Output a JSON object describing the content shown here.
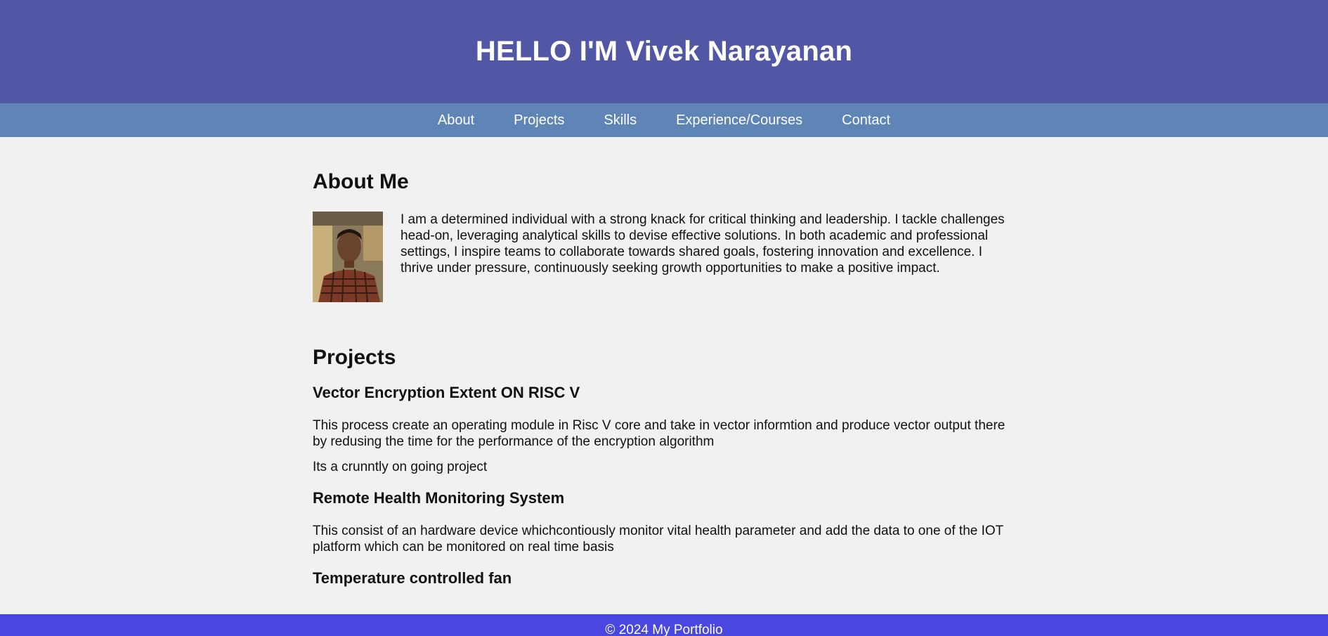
{
  "header": {
    "title": "HELLO I'M Vivek Narayanan"
  },
  "nav": {
    "items": [
      {
        "label": "About"
      },
      {
        "label": "Projects"
      },
      {
        "label": "Skills"
      },
      {
        "label": "Experience/Courses"
      },
      {
        "label": "Contact"
      }
    ]
  },
  "about": {
    "heading": "About Me",
    "text": "I am a determined individual with a strong knack for critical thinking and leadership. I tackle challenges head-on, leveraging analytical skills to devise effective solutions. In both academic and professional settings, I inspire teams to collaborate towards shared goals, fostering innovation and excellence. I thrive under pressure, continuously seeking growth opportunities to make a positive impact."
  },
  "projects": {
    "heading": "Projects",
    "items": [
      {
        "title": "Vector Encryption Extent ON RISC V",
        "description": "This process create an operating module in Risc V core and take in vector informtion and produce vector output there by redusing the time for the performance of the encryption algorithm",
        "note": "Its a crunntly on going project"
      },
      {
        "title": "Remote Health Monitoring System",
        "description": "This consist of an hardware device whichcontiously monitor vital health parameter and add the data to one of the IOT platform which can be monitored on real time basis"
      },
      {
        "title": "Temperature controlled fan"
      }
    ]
  },
  "footer": {
    "text": "© 2024 My Portfolio"
  },
  "colors": {
    "header_bg": "#5257a5",
    "nav_bg": "#5f85b6",
    "footer_bg": "#4a47e0",
    "page_bg": "#f1f1f1"
  }
}
